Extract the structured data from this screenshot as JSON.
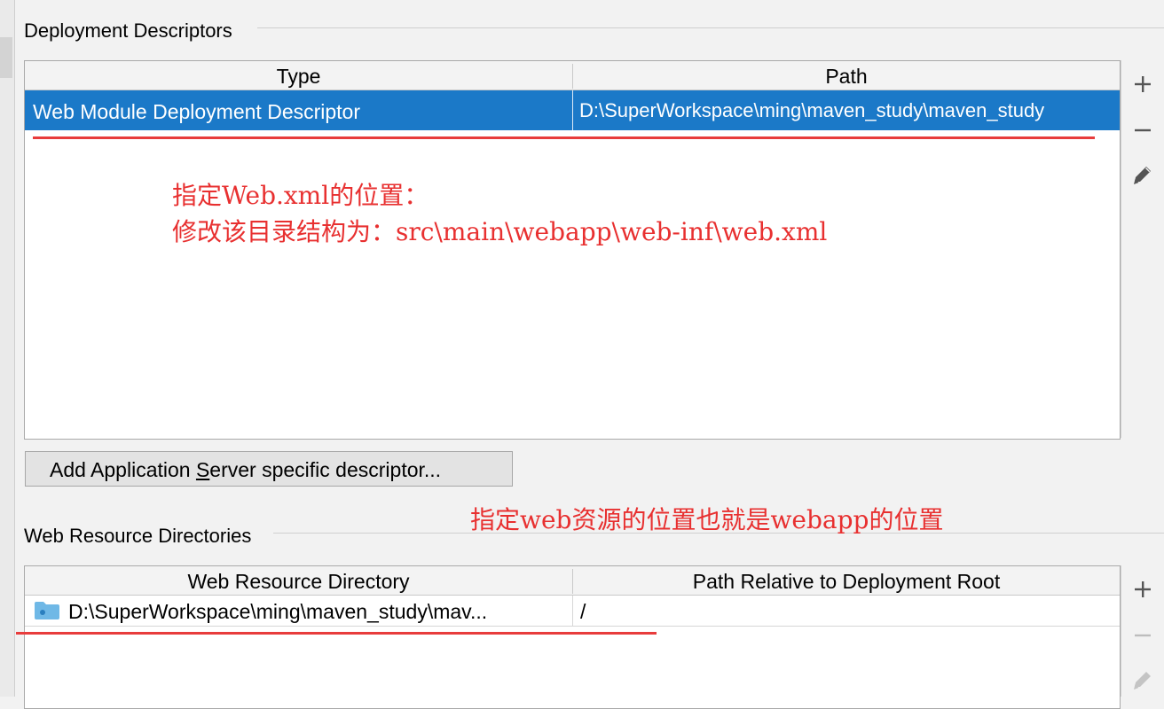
{
  "deployment_descriptors": {
    "title": "Deployment Descriptors",
    "columns": [
      "Type",
      "Path"
    ],
    "rows": [
      {
        "type": "Web Module Deployment Descriptor",
        "path": "D:\\SuperWorkspace\\ming\\maven_study\\maven_study",
        "selected": true
      }
    ],
    "tools": {
      "add": "add-icon",
      "remove": "remove-icon",
      "edit": "edit-icon"
    }
  },
  "annotations": {
    "line1": "指定Web.xml的位置：",
    "line2": "修改该目录结构为：src\\main\\webapp\\web-inf\\web.xml",
    "line3": "指定web资源的位置也就是webapp的位置",
    "color": "#e83030"
  },
  "add_descriptor_button": {
    "before": "Add Application ",
    "mnemonic": "S",
    "after": "erver specific descriptor..."
  },
  "web_resource_directories": {
    "title": "Web Resource Directories",
    "columns": [
      "Web Resource Directory",
      "Path Relative to Deployment Root"
    ],
    "rows": [
      {
        "directory": "D:\\SuperWorkspace\\ming\\maven_study\\mav...",
        "relative_path": "/",
        "icon": "web-folder-icon"
      }
    ],
    "tools": {
      "add": "add-icon",
      "remove": "remove-icon",
      "edit": "edit-icon"
    }
  },
  "colors": {
    "selection": "#1b79c8",
    "annotation": "#e83030",
    "folder": "#6fb8e6"
  }
}
